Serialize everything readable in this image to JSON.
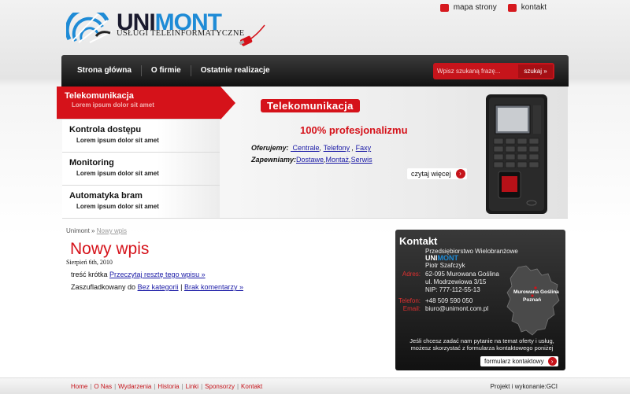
{
  "header": {
    "logo_word_a": "UNI",
    "logo_word_b": "MONT",
    "logo_tagline": "USŁUGI TELEINFORMATYCZNE",
    "toplinks": [
      "mapa strony",
      "kontakt"
    ]
  },
  "nav": {
    "items": [
      "Strona główna",
      "O firmie",
      "Ostatnie realizacje"
    ],
    "search_placeholder": "Wpisz szukaną frazę...",
    "search_button": "szukaj »"
  },
  "side_menu": [
    {
      "title": "Telekomunikacja",
      "sub": "Lorem ipsum dolor sit amet",
      "active": true
    },
    {
      "title": "Kontrola dostępu",
      "sub": "Lorem ipsum dolor sit amet",
      "active": false
    },
    {
      "title": "Monitoring",
      "sub": "Lorem ipsum dolor sit amet",
      "active": false
    },
    {
      "title": "Automatyka bram",
      "sub": "Lorem ipsum dolor sit amet",
      "active": false
    }
  ],
  "slide": {
    "title": "Telekomunikacja",
    "headline": "100% profesjonalizmu",
    "offer_label": "Oferujemy:",
    "offer_links": [
      "Centrale",
      "Telefony",
      "Faxy"
    ],
    "provide_label": "Zapewniamy:",
    "provide_links": [
      "Dostawe",
      "Montaż",
      "Serwis"
    ],
    "read_more": "czytaj więcej"
  },
  "breadcrumb": {
    "home": "Unimont",
    "sep": "»",
    "current": "Nowy wpis"
  },
  "post": {
    "title": "Nowy wpis",
    "date": "Sierpień 6th, 2010",
    "excerpt": "treść krótka",
    "read_link": "Przeczytaj resztę tego wpisu »",
    "filed_label": "Zaszufladkowany do",
    "category_link": "Bez kategorii",
    "comments_link": "Brak komentarzy »"
  },
  "contact": {
    "heading": "Kontakt",
    "company": "Przedsiębiorstwo Wielobranżowe",
    "owner": "Piotr Szafczyk",
    "address_label": "Adres:",
    "address_lines": [
      "62-095 Murowana Goślina",
      "ul. Modrzewiowa 3/15",
      "NIP: 777-112-55-13"
    ],
    "phone_label": "Telefon:",
    "phone": "+48 509 590 050",
    "email_label": "Email:",
    "email": "biuro@unimont.com.pl",
    "map_labels": [
      "Murowana Goślina",
      "Poznań"
    ],
    "note": "Jeśli chcesz zadać nam pytanie na temat oferty i usług, możesz skorzystać z formularza kontaktowego poniżej",
    "form_button": "formularz kontaktowy"
  },
  "footer": {
    "links": [
      "Home",
      "O Nas",
      "Wydarzenia",
      "Historia",
      "Linki",
      "Sponsorzy",
      "Kontakt"
    ],
    "credit": "Projekt i wykonanie:GCI"
  },
  "colors": {
    "accent_red": "#d5121a",
    "brand_blue": "#1e8bd6",
    "dark": "#1a1a1a"
  }
}
